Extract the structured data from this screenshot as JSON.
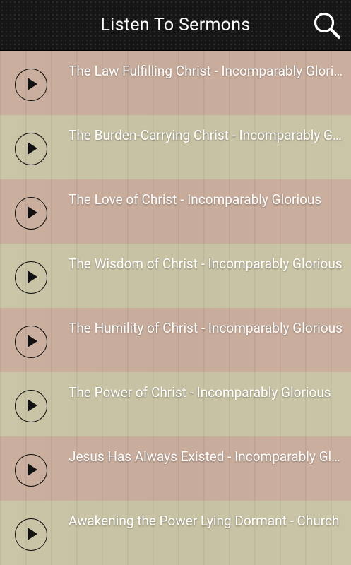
{
  "header": {
    "title": "Listen To Sermons",
    "search_icon": "search-icon"
  },
  "row_colors": [
    "#c9a89a",
    "#c8c7a5"
  ],
  "sermons": [
    {
      "title": "The Law Fulfilling Christ - Incomparably Glorious"
    },
    {
      "title": "The Burden-Carrying Christ - Incomparably Glorious"
    },
    {
      "title": "The Love of Christ - Incomparably Glorious"
    },
    {
      "title": "The Wisdom of Christ - Incomparably Glorious"
    },
    {
      "title": "The Humility of Christ - Incomparably Glorious"
    },
    {
      "title": "The Power of Christ - Incomparably Glorious"
    },
    {
      "title": "Jesus Has Always Existed - Incomparably Glorious"
    },
    {
      "title": "Awakening the Power Lying Dormant - Church"
    }
  ]
}
